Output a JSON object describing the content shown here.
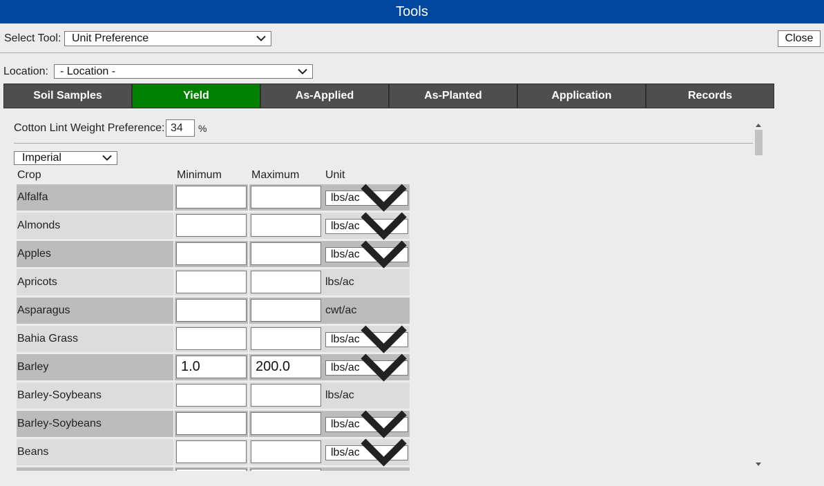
{
  "window": {
    "title": "Tools"
  },
  "toolbar": {
    "select_tool_label": "Select Tool:",
    "select_tool_value": "Unit Preference",
    "close_label": "Close"
  },
  "location": {
    "label": "Location:",
    "value": "- Location -"
  },
  "tabs": [
    {
      "label": "Soil Samples",
      "active": false
    },
    {
      "label": "Yield",
      "active": true
    },
    {
      "label": "As-Applied",
      "active": false
    },
    {
      "label": "As-Planted",
      "active": false
    },
    {
      "label": "Application",
      "active": false
    },
    {
      "label": "Records",
      "active": false
    }
  ],
  "cotton": {
    "label": "Cotton Lint Weight Preference:",
    "value": "34",
    "unit": "%"
  },
  "system_select": {
    "value": "Imperial"
  },
  "table": {
    "headers": {
      "crop": "Crop",
      "min": "Minimum",
      "max": "Maximum",
      "unit": "Unit"
    },
    "rows": [
      {
        "crop": "Alfalfa",
        "min": "",
        "max": "",
        "unit": "lbs/ac",
        "unit_selectable": true
      },
      {
        "crop": "Almonds",
        "min": "",
        "max": "",
        "unit": "lbs/ac",
        "unit_selectable": true
      },
      {
        "crop": "Apples",
        "min": "",
        "max": "",
        "unit": "lbs/ac",
        "unit_selectable": true
      },
      {
        "crop": "Apricots",
        "min": "",
        "max": "",
        "unit": "lbs/ac",
        "unit_selectable": false
      },
      {
        "crop": "Asparagus",
        "min": "",
        "max": "",
        "unit": "cwt/ac",
        "unit_selectable": false
      },
      {
        "crop": "Bahia Grass",
        "min": "",
        "max": "",
        "unit": "lbs/ac",
        "unit_selectable": true
      },
      {
        "crop": "Barley",
        "min": "1.0",
        "max": "200.0",
        "unit": "lbs/ac",
        "unit_selectable": true
      },
      {
        "crop": "Barley-Soybeans",
        "min": "",
        "max": "",
        "unit": "lbs/ac",
        "unit_selectable": false
      },
      {
        "crop": "Barley-Soybeans",
        "min": "",
        "max": "",
        "unit": "lbs/ac",
        "unit_selectable": true
      },
      {
        "crop": "Beans",
        "min": "",
        "max": "",
        "unit": "lbs/ac",
        "unit_selectable": true
      },
      {
        "crop": "",
        "min": "",
        "max": "",
        "unit": "",
        "unit_selectable": false
      }
    ]
  },
  "icons": {
    "dropdown": "chevron-down-icon",
    "scroll_up": "scroll-up-arrow-icon",
    "scroll_down": "scroll-down-arrow-icon"
  }
}
